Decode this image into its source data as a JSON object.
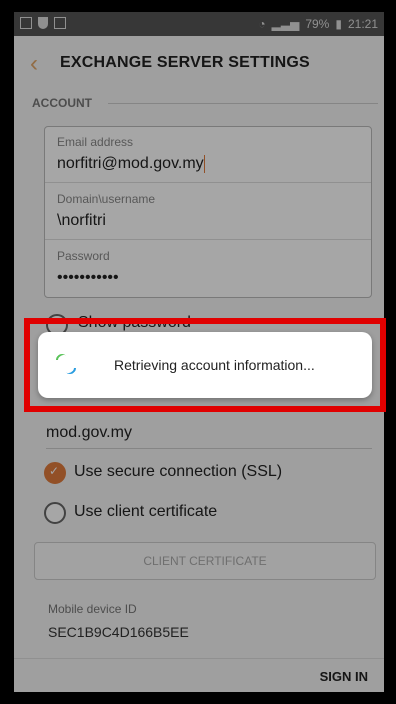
{
  "status_bar": {
    "battery": "79%",
    "time": "21:21"
  },
  "app_bar": {
    "title": "EXCHANGE SERVER SETTINGS"
  },
  "account_section": {
    "label": "ACCOUNT"
  },
  "fields": [
    {
      "label": "Email address",
      "value": "norfitri@mod.gov.my"
    },
    {
      "label": "Domain\\username",
      "value": "\\norfitri"
    },
    {
      "label": "Password",
      "value": "•••••••••••"
    }
  ],
  "options": {
    "show_password": "Show password",
    "server_value": "mod.gov.my",
    "ssl": "Use secure connection (SSL)",
    "client_cert": "Use client certificate"
  },
  "client_cert_button": "CLIENT CERTIFICATE",
  "device": {
    "label": "Mobile device ID",
    "value": "SEC1B9C4D166B5EE"
  },
  "actions": {
    "sign_in": "SIGN IN"
  },
  "dialog": {
    "text": "Retrieving account information..."
  },
  "colors": {
    "accent": "#e07b3c",
    "highlight": "#e00000"
  }
}
